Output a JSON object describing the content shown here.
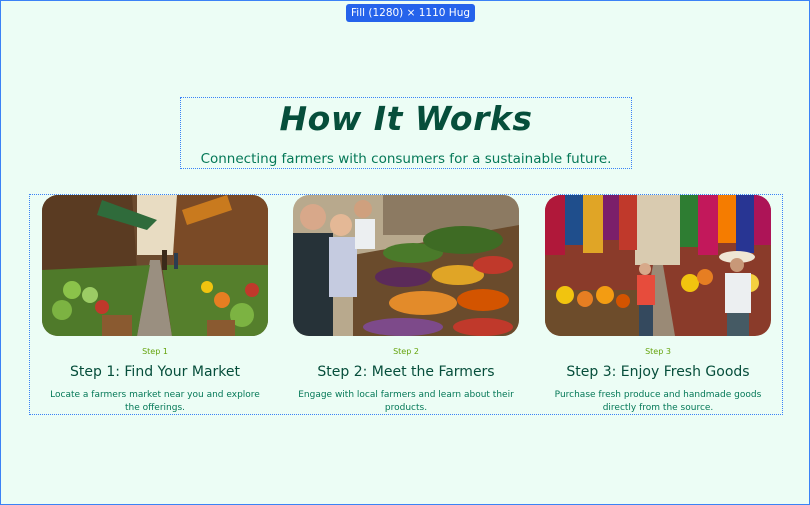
{
  "frame_badge": "Fill (1280) × 1110 Hug",
  "header": {
    "title": "How It Works",
    "subtitle": "Connecting farmers with consumers for a sustainable future."
  },
  "steps": [
    {
      "number": "Step 1",
      "title": "Step 1: Find Your Market",
      "description": "Locate a farmers market near you and explore the offerings."
    },
    {
      "number": "Step 2",
      "title": "Step 2: Meet the Farmers",
      "description": "Engage with local farmers and learn about their products."
    },
    {
      "number": "Step 3",
      "title": "Step 3: Enjoy Fresh Goods",
      "description": "Purchase fresh produce and handmade goods directly from the source."
    }
  ],
  "colors": {
    "background": "#ecfdf5",
    "title": "#064e3b",
    "subtitle": "#047857",
    "step_number": "#65a30d",
    "selection": "#3b82f6"
  }
}
